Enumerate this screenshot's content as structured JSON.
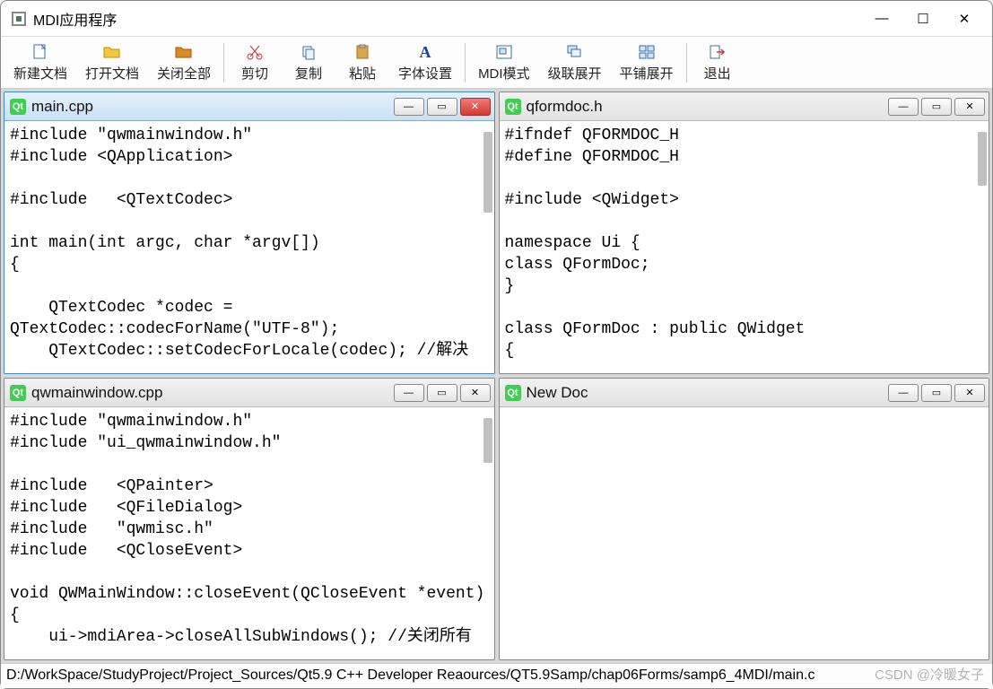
{
  "window": {
    "title": "MDI应用程序",
    "min_glyph": "—",
    "max_glyph": "☐",
    "close_glyph": "✕"
  },
  "toolbar": {
    "new_doc": "新建文档",
    "open_doc": "打开文档",
    "close_all": "关闭全部",
    "cut": "剪切",
    "copy": "复制",
    "paste": "粘贴",
    "font": "字体设置",
    "mdi_mode": "MDI模式",
    "cascade": "级联展开",
    "tile": "平铺展开",
    "exit": "退出"
  },
  "icons": {
    "qt": "Qt"
  },
  "subwindows": {
    "main_cpp": {
      "title": "main.cpp",
      "content": "#include \"qwmainwindow.h\"\n#include <QApplication>\n\n#include   <QTextCodec>\n\nint main(int argc, char *argv[])\n{\n\n    QTextCodec *codec =\nQTextCodec::codecForName(\"UTF-8\");\n    QTextCodec::setCodecForLocale(codec); //解决"
    },
    "qformdoc_h": {
      "title": "qformdoc.h",
      "content": "#ifndef QFORMDOC_H\n#define QFORMDOC_H\n\n#include <QWidget>\n\nnamespace Ui {\nclass QFormDoc;\n}\n\nclass QFormDoc : public QWidget\n{"
    },
    "qwmainwindow_cpp": {
      "title": "qwmainwindow.cpp",
      "content": "#include \"qwmainwindow.h\"\n#include \"ui_qwmainwindow.h\"\n\n#include   <QPainter>\n#include   <QFileDialog>\n#include   \"qwmisc.h\"\n#include   <QCloseEvent>\n\nvoid QWMainWindow::closeEvent(QCloseEvent *event)\n{\n    ui->mdiArea->closeAllSubWindows(); //关闭所有"
    },
    "new_doc": {
      "title": "New Doc",
      "content": ""
    }
  },
  "sub_btn_glyphs": {
    "min": "—",
    "max": "▭",
    "close": "✕"
  },
  "status": "D:/WorkSpace/StudyProject/Project_Sources/Qt5.9 C++ Developer Reaources/QT5.9Samp/chap06Forms/samp6_4MDI/main.c",
  "watermark": "CSDN @冷暖女子"
}
